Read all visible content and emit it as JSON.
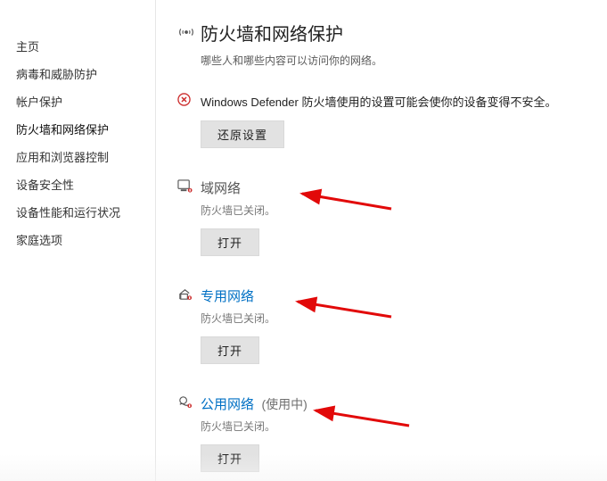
{
  "sidebar": {
    "items": [
      {
        "label": "主页"
      },
      {
        "label": "病毒和威胁防护"
      },
      {
        "label": "帐户保护"
      },
      {
        "label": "防火墙和网络保护"
      },
      {
        "label": "应用和浏览器控制"
      },
      {
        "label": "设备安全性"
      },
      {
        "label": "设备性能和运行状况"
      },
      {
        "label": "家庭选项"
      }
    ]
  },
  "header": {
    "title": "防火墙和网络保护",
    "subtitle": "哪些人和哪些内容可以访问你的网络。"
  },
  "warning": {
    "text": "Windows Defender 防火墙使用的设置可能会使你的设备变得不安全。",
    "button_label": "还原设置"
  },
  "sections": [
    {
      "title": "域网络",
      "is_link": false,
      "in_use": false,
      "status": "防火墙已关闭。",
      "button_label": "打开"
    },
    {
      "title": "专用网络",
      "is_link": true,
      "in_use": false,
      "status": "防火墙已关闭。",
      "button_label": "打开"
    },
    {
      "title": "公用网络",
      "is_link": true,
      "in_use": true,
      "status": "防火墙已关闭。",
      "button_label": "打开"
    }
  ],
  "labels": {
    "in_use": "(使用中)"
  },
  "colors": {
    "link": "#0070c4",
    "warn_x": "#cc2c2c",
    "arrow": "#e20909",
    "btn_bg": "#e2e2e2"
  }
}
